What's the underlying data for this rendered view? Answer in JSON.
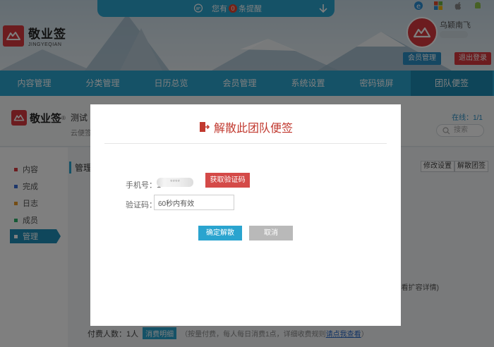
{
  "header": {
    "logo_cn": "敬业签",
    "logo_en": "JINGYEQIAN",
    "notice": {
      "prefix": "您有",
      "count": "0",
      "suffix": "条提醒"
    },
    "platform_icons": [
      "ie-icon",
      "windows-icon",
      "apple-icon",
      "android-icon"
    ],
    "username": "乌颖南飞",
    "member_button": "会员管理",
    "logout_button": "退出登录"
  },
  "nav": {
    "items": [
      "内容管理",
      "分类管理",
      "日历总览",
      "会员管理",
      "系统设置",
      "密码锁屏",
      "团队便签"
    ],
    "active_index": 6
  },
  "subheader": {
    "logo_cn": "敬业签",
    "registered": "®",
    "title": "测试",
    "desc": "云便签",
    "online_label": "在线：",
    "online_value": "1/1",
    "search_placeholder": "搜索"
  },
  "sidebar": {
    "items": [
      {
        "label": "内容",
        "color": "#d9383f"
      },
      {
        "label": "完成",
        "color": "#3b6fd6"
      },
      {
        "label": "日志",
        "color": "#e89a2a"
      },
      {
        "label": "成员",
        "color": "#2bb36a"
      },
      {
        "label": "管理",
        "color": "#ffffff"
      }
    ],
    "active_index": 4
  },
  "main": {
    "title": "管理",
    "btn_edit": "修改设置",
    "btn_disband": "解散团签",
    "peek_right": "看扩容详情)",
    "pay": {
      "label": "付费人数：",
      "value": "1人",
      "detail_button": "消费明细",
      "note": "（按量付费，每人每日消费1点，详细收费规则",
      "link": "请点我查看",
      "note_end": "）"
    }
  },
  "modal": {
    "title": "解散此团队便签",
    "phone_label": "手机号：",
    "phone_value": "1",
    "phone_mask": "****",
    "get_code_button": "获取验证码",
    "code_label": "验证码：",
    "code_value": "60秒内有效",
    "confirm_button": "确定解散",
    "cancel_button": "取消"
  },
  "colors": {
    "primary": "#2aa4cf",
    "danger": "#d9383f",
    "overlay": "rgba(0,0,0,0.5)"
  }
}
